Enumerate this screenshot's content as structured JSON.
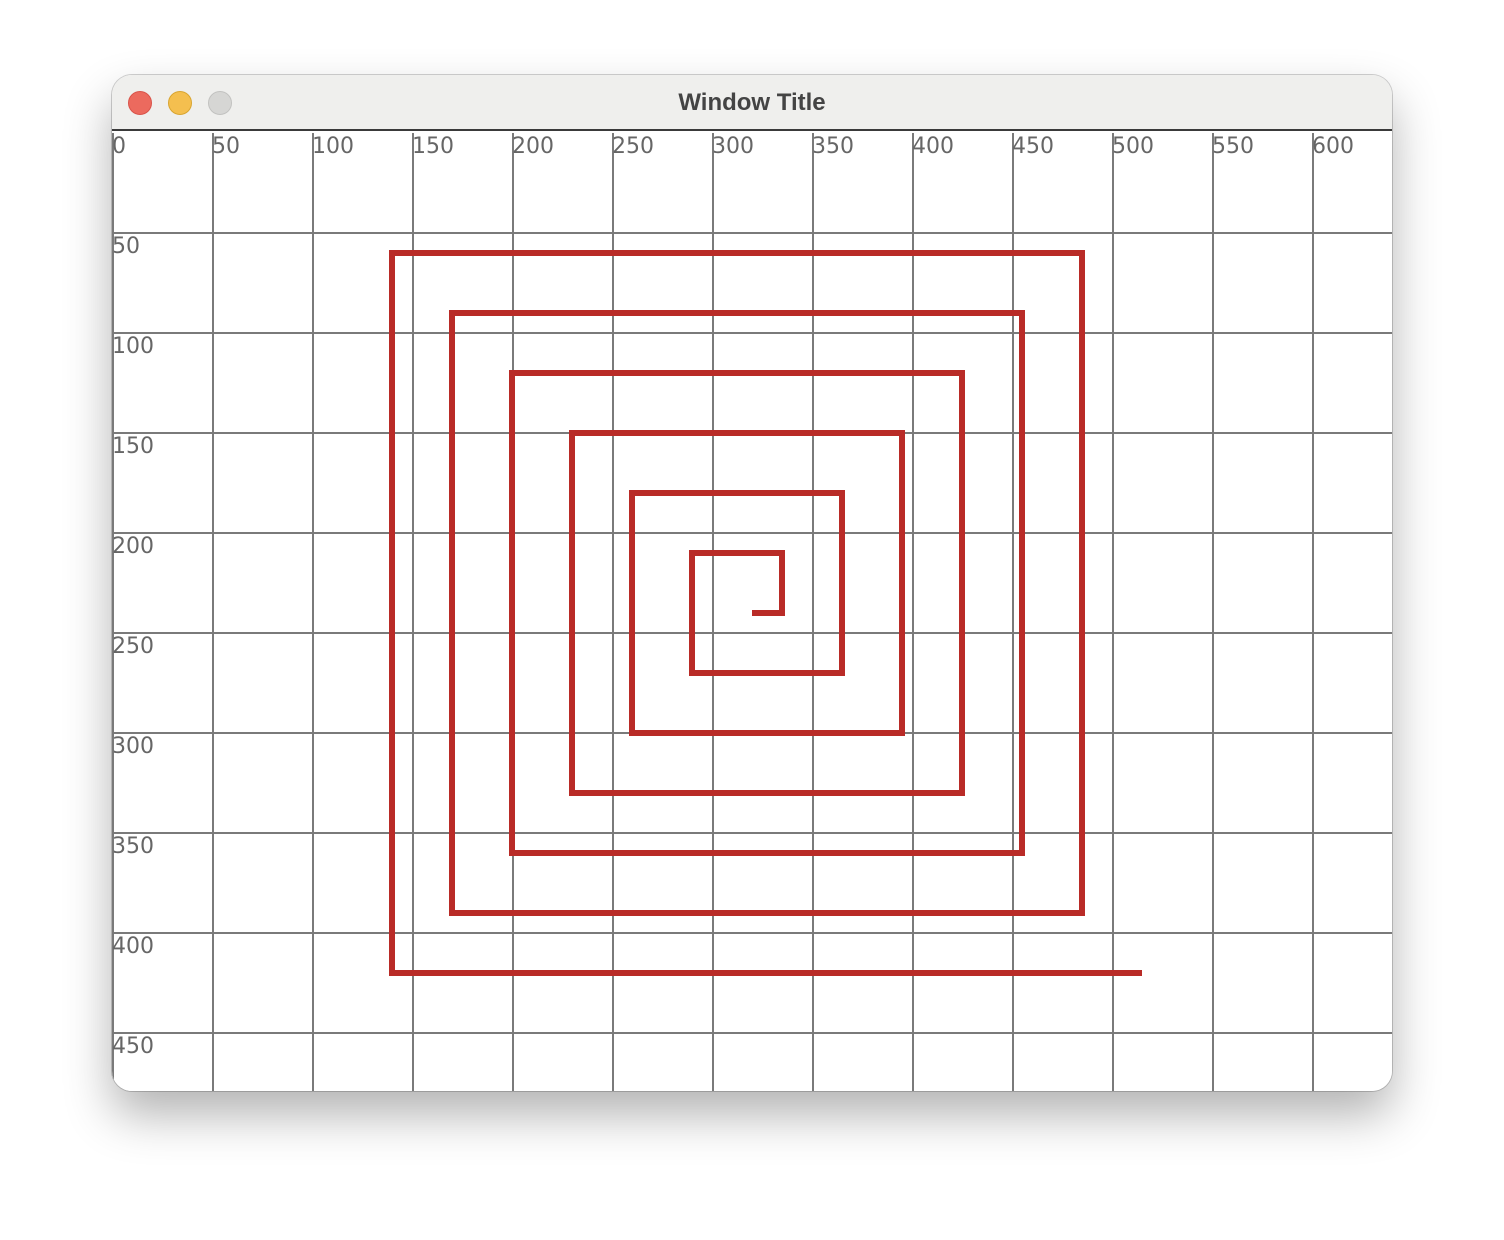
{
  "window": {
    "title": "Window Title"
  },
  "controls": {
    "close_color": "#ec6a5e",
    "minimize_color": "#f4bf4f",
    "zoom_color": "#d6d6d4"
  },
  "grid": {
    "x_ticks": [
      "0",
      "50",
      "100",
      "150",
      "200",
      "250",
      "300",
      "350",
      "400",
      "450",
      "500",
      "550",
      "600"
    ],
    "y_ticks": [
      "50",
      "100",
      "150",
      "200",
      "250",
      "300",
      "350",
      "400",
      "450"
    ],
    "line_color": "#7a7a7a"
  },
  "spiral": {
    "color": "#b92b27",
    "points": [
      [
        320,
        240
      ],
      [
        335,
        240
      ],
      [
        335,
        210
      ],
      [
        290,
        210
      ],
      [
        290,
        270
      ],
      [
        365,
        270
      ],
      [
        365,
        180
      ],
      [
        260,
        180
      ],
      [
        260,
        300
      ],
      [
        395,
        300
      ],
      [
        395,
        150
      ],
      [
        230,
        150
      ],
      [
        230,
        330
      ],
      [
        425,
        330
      ],
      [
        425,
        120
      ],
      [
        200,
        120
      ],
      [
        200,
        360
      ],
      [
        455,
        360
      ],
      [
        455,
        90
      ],
      [
        170,
        90
      ],
      [
        170,
        390
      ],
      [
        485,
        390
      ],
      [
        485,
        60
      ],
      [
        140,
        60
      ],
      [
        140,
        420
      ],
      [
        515,
        420
      ]
    ]
  }
}
